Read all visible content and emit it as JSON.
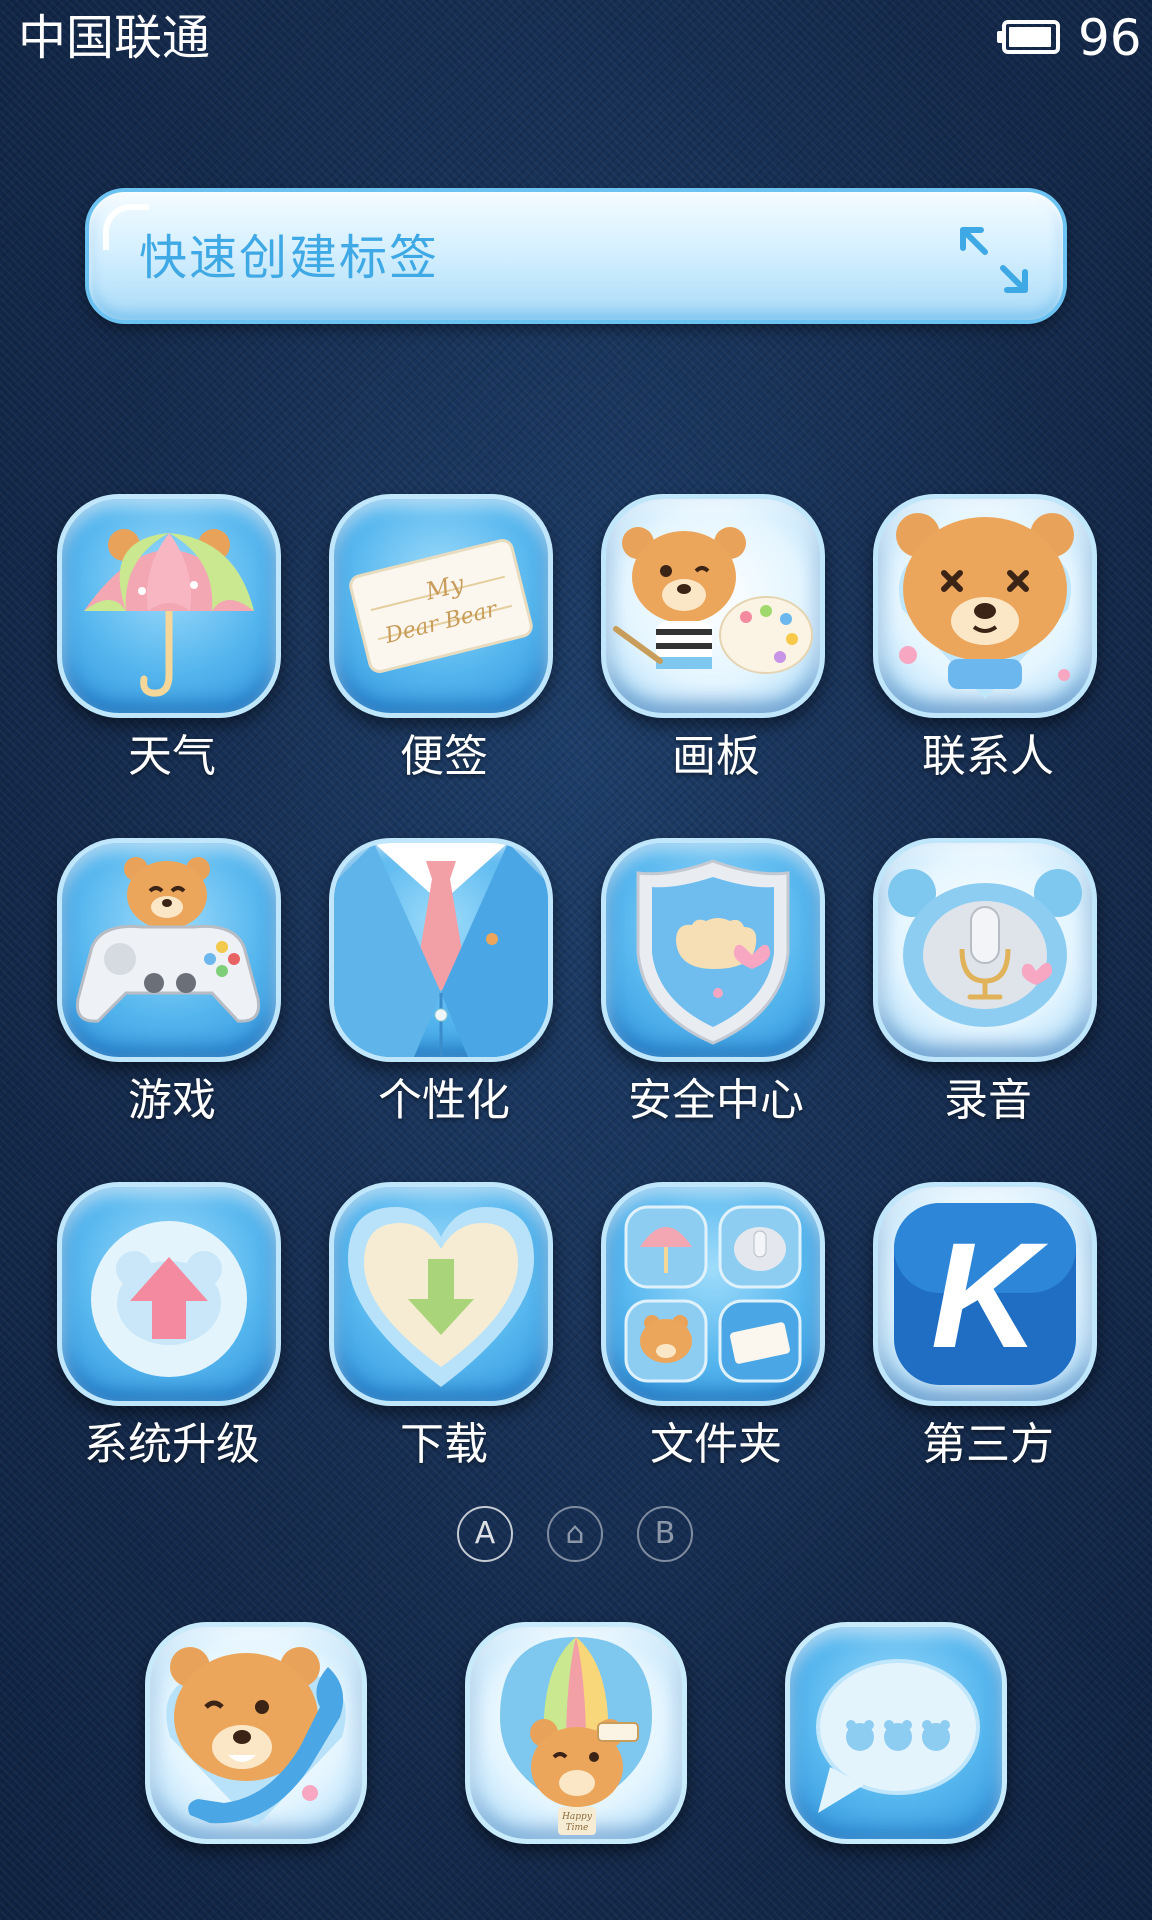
{
  "status_bar": {
    "carrier": "中国联通",
    "battery_level": "96",
    "battery_fraction": 0.96
  },
  "tag_widget": {
    "label": "快速创建标签",
    "icon": "expand-icon"
  },
  "apps": [
    {
      "label": "天气",
      "icon": "umbrella-icon"
    },
    {
      "label": "便签",
      "icon": "note-card-icon",
      "card_text_1": "My",
      "card_text_2": "Dear Bear"
    },
    {
      "label": "画板",
      "icon": "palette-bear-icon"
    },
    {
      "label": "联系人",
      "icon": "bear-face-icon"
    },
    {
      "label": "游戏",
      "icon": "gamepad-icon"
    },
    {
      "label": "个性化",
      "icon": "suit-tie-icon"
    },
    {
      "label": "安全中心",
      "icon": "shield-icon"
    },
    {
      "label": "录音",
      "icon": "microphone-icon"
    },
    {
      "label": "系统升级",
      "icon": "upgrade-arrow-icon"
    },
    {
      "label": "下载",
      "icon": "heart-download-icon"
    },
    {
      "label": "文件夹",
      "icon": "folder-icon"
    },
    {
      "label": "第三方",
      "icon": "k-letter-icon",
      "letter": "K"
    }
  ],
  "page_indicator": [
    {
      "label": "A"
    },
    {
      "label": "⌂",
      "icon": "home-icon"
    },
    {
      "label": "B"
    }
  ],
  "dock": [
    {
      "icon": "phone-bear-icon"
    },
    {
      "icon": "balloon-bear-icon",
      "balloon_text_1": "Happy",
      "balloon_text_2": "Time"
    },
    {
      "icon": "message-bubble-icon"
    }
  ]
}
